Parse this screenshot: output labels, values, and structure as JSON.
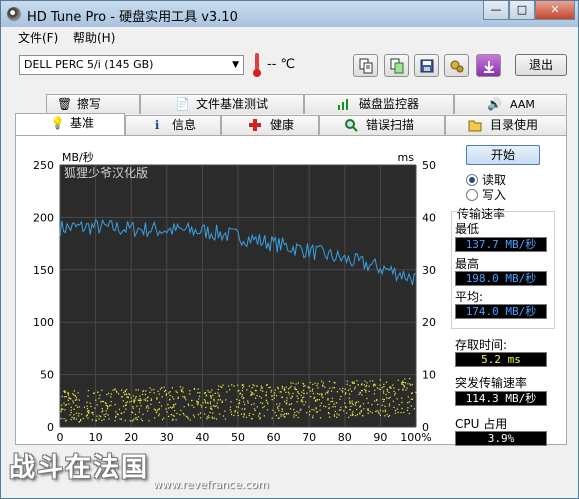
{
  "window": {
    "title": "HD Tune Pro - 硬盘实用工具 v3.10"
  },
  "title_buttons": {
    "minimize": "—",
    "maximize": "□",
    "close": "✕"
  },
  "menu": {
    "file": "文件(F)",
    "help": "帮助(H)"
  },
  "toolbar": {
    "drive": "DELL    PERC 5/i (145 GB)",
    "temperature": "-- ℃",
    "exit_label": "退出",
    "icons": [
      "copy-info-icon",
      "copy-screen-icon",
      "save-icon",
      "options-icon",
      "minimize-tray-icon"
    ]
  },
  "tabs_top": [
    {
      "label": "擦写",
      "icon": "trash-icon"
    },
    {
      "label": "文件基准测试",
      "icon": "file-benchmark-icon"
    },
    {
      "label": "磁盘监控器",
      "icon": "monitor-icon"
    },
    {
      "label": "AAM",
      "icon": "speaker-icon"
    }
  ],
  "tabs_bottom": [
    {
      "label": "基准",
      "icon": "bulb-icon",
      "active": true
    },
    {
      "label": "信息",
      "icon": "info-icon"
    },
    {
      "label": "健康",
      "icon": "health-cross-icon"
    },
    {
      "label": "错误扫描",
      "icon": "magnifier-icon"
    },
    {
      "label": "目录使用",
      "icon": "folder-icon"
    }
  ],
  "chart_data": {
    "type": "scatter",
    "overlay_text": "狐狸少爷汉化版",
    "left_axis": {
      "unit": "MB/秒",
      "ticks": [
        0,
        50,
        100,
        150,
        200,
        250
      ],
      "range": [
        0,
        250
      ]
    },
    "right_axis": {
      "unit": "ms",
      "ticks": [
        0,
        10,
        20,
        30,
        40,
        50
      ],
      "range": [
        0,
        50
      ]
    },
    "x_axis": {
      "ticks": [
        "0",
        "10",
        "20",
        "30",
        "40",
        "50",
        "60",
        "70",
        "80",
        "90",
        "100%"
      ],
      "range": [
        0,
        100
      ]
    },
    "series": [
      {
        "name": "传输速率",
        "color": "#3aa0e0",
        "x": [
          0,
          10,
          20,
          30,
          40,
          50,
          60,
          70,
          80,
          90,
          95,
          100
        ],
        "y": [
          190,
          191,
          189,
          188,
          187,
          182,
          175,
          168,
          160,
          152,
          147,
          141
        ]
      },
      {
        "name": "存取时间",
        "color": "#f0f040",
        "x_range": [
          0,
          100
        ],
        "y_range_ms": [
          1,
          10
        ],
        "mean_ms": 5.2
      }
    ],
    "colors": {
      "background": "#2b2b2b",
      "grid": "#4a4a4a",
      "axis_text": "#000000"
    }
  },
  "controls": {
    "start": "开始",
    "read": "读取",
    "write": "写入",
    "read_selected": true
  },
  "stats": {
    "transfer_title": "传输速率",
    "min_label": "最低",
    "min_value": "137.7 MB/秒",
    "max_label": "最高",
    "max_value": "198.0 MB/秒",
    "avg_label": "平均:",
    "avg_value": "174.0 MB/秒",
    "access_label": "存取时间:",
    "access_value": "5.2 ms",
    "burst_label": "突发传输速率",
    "burst_value": "114.3 MB/秒",
    "cpu_label": "CPU 占用",
    "cpu_value": "3.9%"
  },
  "watermark": {
    "site_cn": "战斗在法国",
    "url": "www.revefrance.com"
  }
}
